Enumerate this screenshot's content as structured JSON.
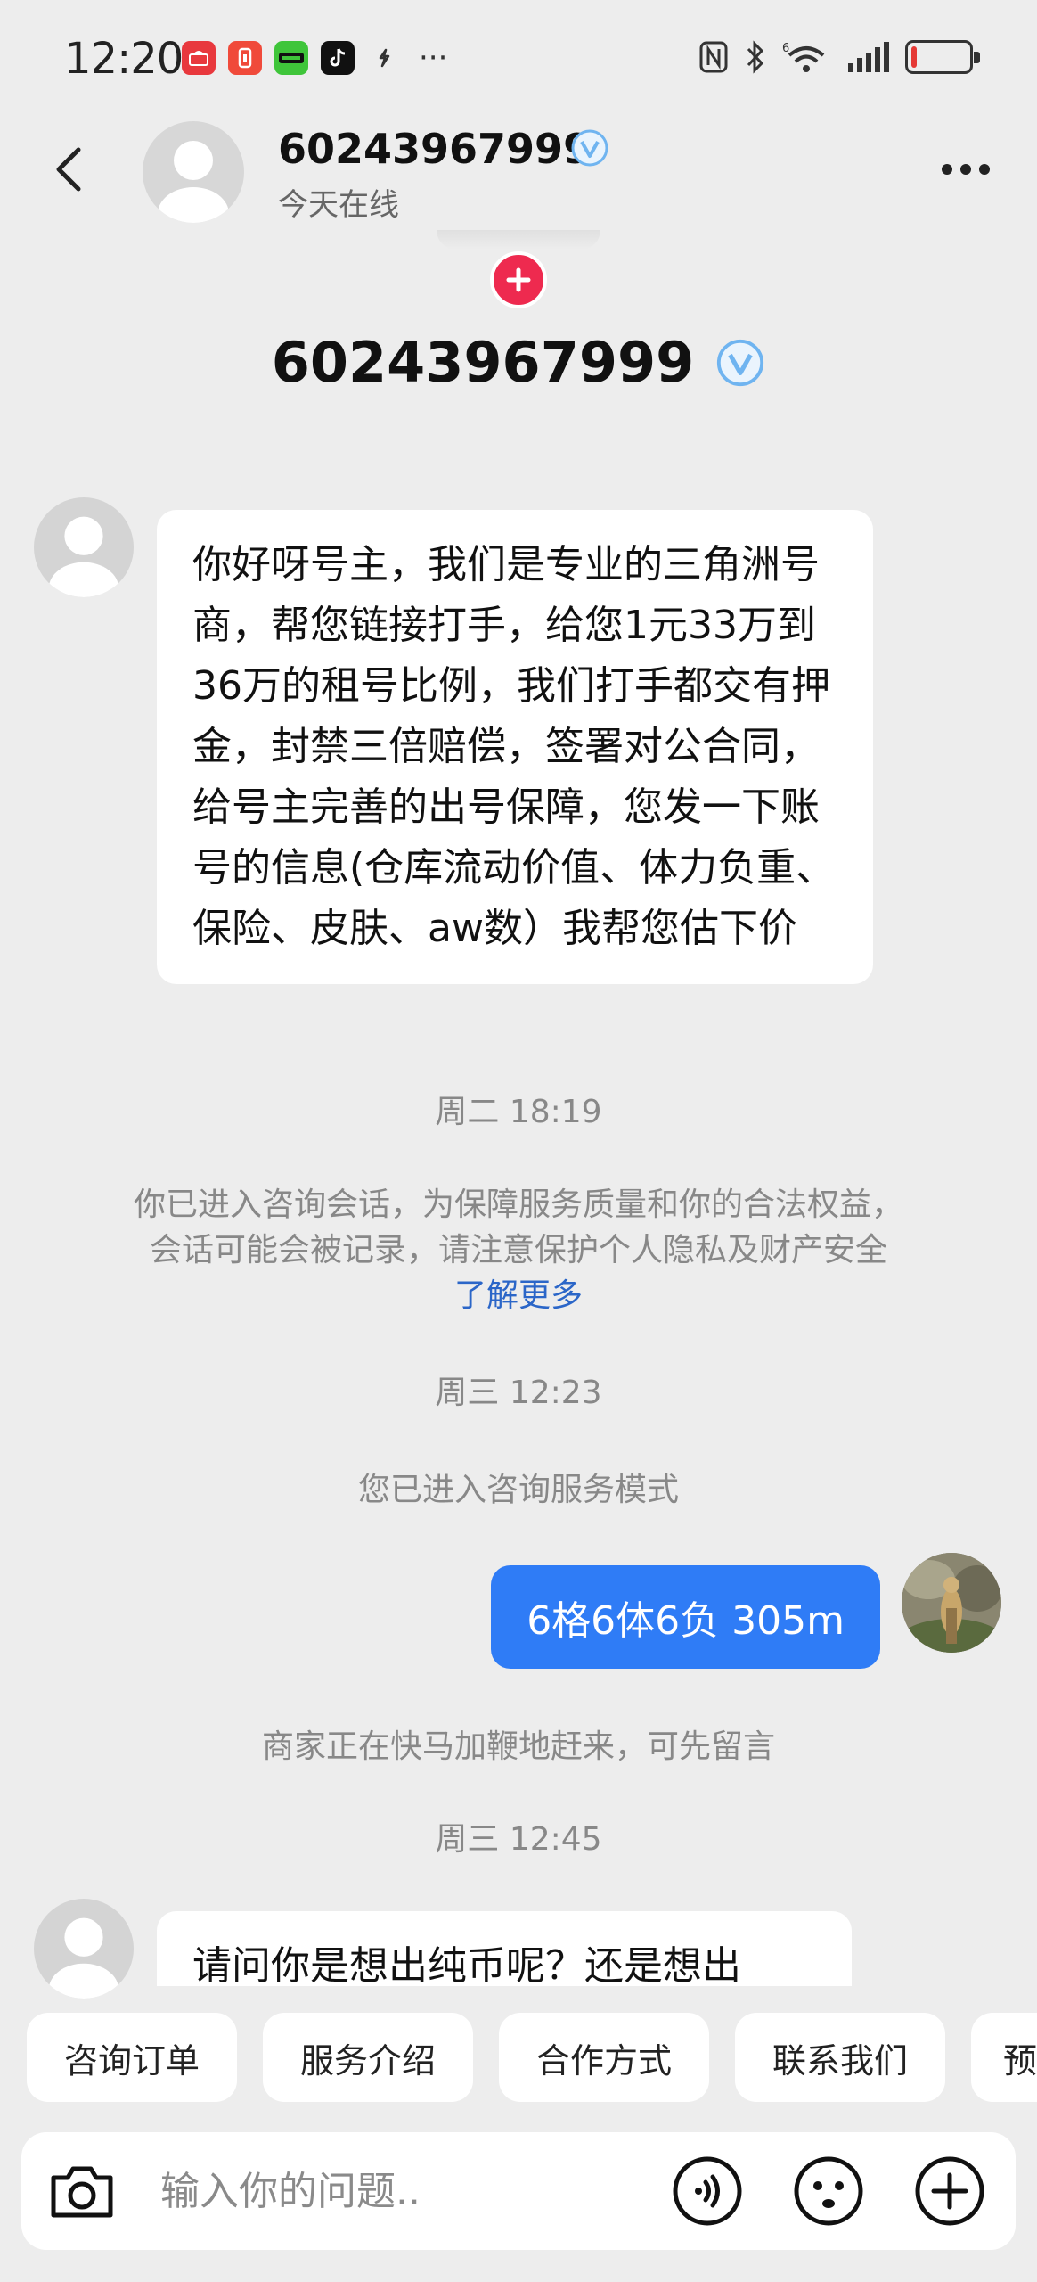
{
  "status_bar": {
    "time": "12:20",
    "app_icons": [
      {
        "name": "huawei-app-icon",
        "color": "#e8383d"
      },
      {
        "name": "notification-app-icon",
        "color": "#f04a3a"
      },
      {
        "name": "game-app-icon",
        "color": "#3fc53a"
      },
      {
        "name": "tiktok-app-icon",
        "color": "#111111"
      },
      {
        "name": "link-app-icon",
        "color": "#333333"
      }
    ],
    "more": "···",
    "battery_level": 0.08
  },
  "header": {
    "contact_name": "60243967999",
    "status": "今天在线"
  },
  "profile": {
    "name": "60243967999"
  },
  "messages": {
    "incoming_1": "你好呀号主，我们是专业的三角洲号商，帮您链接打手，给您1元33万到36万的租号比例，我们打手都交有押金，封禁三倍赔偿，签署对公合同，给号主完善的出号保障，您发一下账号的信息(仓库流动价值、体力负重、保险、皮肤、aw数）我帮您估下价",
    "timestamp_1": "周二 18:19",
    "system_notice": "你已进入咨询会话，为保障服务质量和你的合法权益，会话可能会被记录，请注意保护个人隐私及财产安全",
    "system_notice_link": "了解更多",
    "timestamp_2": "周三 12:23",
    "service_mode": "您已进入咨询服务模式",
    "outgoing_1": "6格6体6负  305m",
    "merchant_notice": "商家正在快马加鞭地赶来，可先留言",
    "timestamp_3": "周三 12:45",
    "incoming_2": "请问你是想出纯币呢？还是想出"
  },
  "quick_replies": [
    "咨询订单",
    "服务介绍",
    "合作方式",
    "联系我们",
    "预"
  ],
  "input_bar": {
    "placeholder": "输入你的问题.."
  },
  "colors": {
    "accent": "#2f7cf6",
    "verify": "#6fb4f0",
    "follow": "#ee2a4f",
    "link": "#2b66c8"
  }
}
